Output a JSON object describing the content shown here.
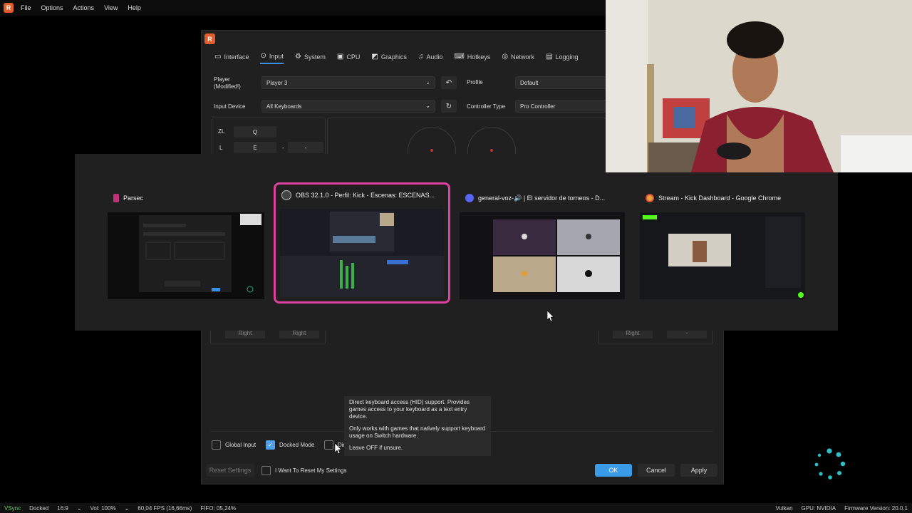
{
  "menubar": {
    "items": [
      "File",
      "Options",
      "Actions",
      "View",
      "Help"
    ]
  },
  "dialog": {
    "tabs": [
      {
        "label": "Interface",
        "icon": "monitor-icon"
      },
      {
        "label": "Input",
        "icon": "gamepad-icon"
      },
      {
        "label": "System",
        "icon": "gear-icon"
      },
      {
        "label": "CPU",
        "icon": "cpu-icon"
      },
      {
        "label": "Graphics",
        "icon": "image-icon"
      },
      {
        "label": "Audio",
        "icon": "music-icon"
      },
      {
        "label": "Hotkeys",
        "icon": "keyboard-icon"
      },
      {
        "label": "Network",
        "icon": "globe-icon"
      },
      {
        "label": "Logging",
        "icon": "document-icon"
      }
    ],
    "player_label": "Player (Modified!)",
    "player_value": "Player 3",
    "profile_label": "Profile",
    "profile_value": "Default",
    "input_device_label": "Input Device",
    "input_device_value": "All Keyboards",
    "controller_type_label": "Controller Type",
    "controller_type_value": "Pro Controller",
    "keys": {
      "zl": "ZL",
      "zl_val": "Q",
      "l": "L",
      "l_val": "E",
      "dash1": "-",
      "dash2": "-"
    },
    "lower_keys": {
      "left_a": "Right",
      "left_b": "Right",
      "right_a": "Right",
      "right_b": "-"
    },
    "checkboxes": {
      "global_input": {
        "label": "Global Input",
        "checked": false
      },
      "docked_mode": {
        "label": "Docked Mode",
        "checked": true
      },
      "direct": {
        "label": "Dir",
        "checked": false
      }
    },
    "tooltip": {
      "p1": "Direct keyboard access (HID) support. Provides games access to your keyboard as a text entry device.",
      "p2": "Only works with games that natively support keyboard usage on Switch hardware.",
      "p3": "Leave OFF if unsure."
    },
    "reset_settings": "Reset Settings",
    "reset_confirm": "I Want To Reset My Settings",
    "ok": "OK",
    "cancel": "Cancel",
    "apply": "Apply"
  },
  "switcher": {
    "windows": [
      {
        "title": "Parsec",
        "icon_color": "#c2307a"
      },
      {
        "title": "OBS 32.1.0 - Perfil: Kick - Escenas: ESCENAS...",
        "icon_color": "#444444"
      },
      {
        "title": "general-voz-🔊 | El servidor de torneos - D...",
        "icon_color": "#5865f2"
      },
      {
        "title": "Stream - Kick Dashboard - Google Chrome",
        "icon_color": "#e8a23a"
      }
    ],
    "selected_index": 1,
    "accent": "#e040a0"
  },
  "statusbar": {
    "vsync": "VSync",
    "docked": "Docked",
    "aspect": "16:9",
    "volume": "Vol: 100%",
    "fps": "60,04 FPS (16,66ms)",
    "fifo": "FIFO: 05,24%",
    "backend": "Vulkan",
    "gpu": "GPU: NVIDIA",
    "firmware": "Firmware Version: 20.0.1"
  }
}
